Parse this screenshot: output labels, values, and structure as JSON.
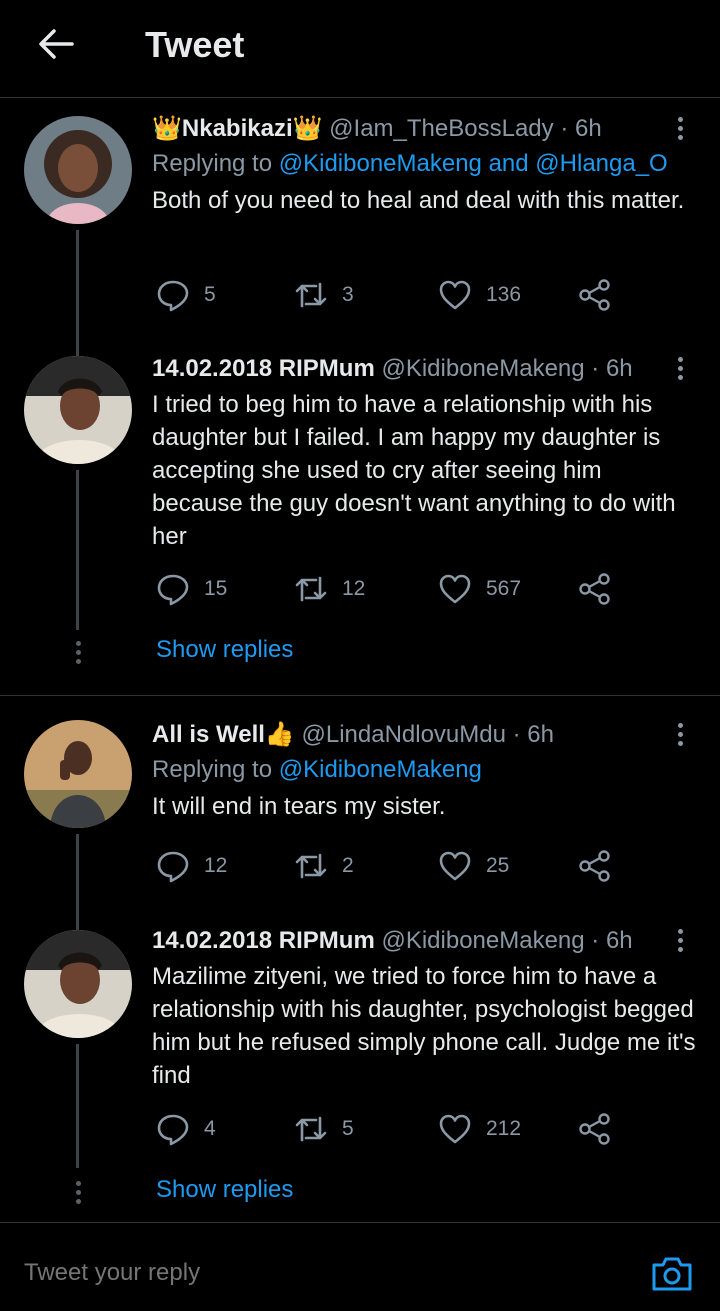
{
  "header": {
    "title": "Tweet",
    "back_icon": "arrow-left-icon"
  },
  "colors": {
    "background": "#000000",
    "link": "#1d9bf0",
    "muted": "#8b98a5",
    "text": "#e7e9ea"
  },
  "tweets": [
    {
      "name": "Nkabikazi",
      "name_emoji_before": "👑",
      "name_emoji_after": "👑",
      "handle": "@Iam_TheBossLady · 6h",
      "replying_prefix": "Replying to ",
      "replying_to": "@KidiboneMakeng and @Hlanga_O",
      "text": "Both of you need to heal and deal with this matter.",
      "replies": "5",
      "retweets": "3",
      "likes": "136"
    },
    {
      "name": "14.02.2018 RIPMum",
      "handle": "@KidiboneMakeng · 6h",
      "text": "I tried to beg him to have a relationship with his daughter but I failed. I am happy my daughter is accepting she used to cry after seeing him because the guy doesn't want anything to do with her",
      "replies": "15",
      "retweets": "12",
      "likes": "567",
      "show_replies": "Show replies"
    },
    {
      "name": "All is Well",
      "name_emoji_after": "👍",
      "handle": "@LindaNdlovuMdu · 6h",
      "replying_prefix": "Replying to ",
      "replying_to": "@KidiboneMakeng",
      "text": "It will end in tears my sister.",
      "replies": "12",
      "retweets": "2",
      "likes": "25"
    },
    {
      "name": "14.02.2018 RIPMum",
      "handle": "@KidiboneMakeng · 6h",
      "text": "Mazilime zityeni, we tried to force him to have a relationship with his daughter, psychologist begged him but he refused simply phone call. Judge me it's find",
      "replies": "4",
      "retweets": "5",
      "likes": "212",
      "show_replies": "Show replies"
    }
  ],
  "composer": {
    "placeholder": "Tweet your reply",
    "camera_icon": "camera-icon"
  }
}
